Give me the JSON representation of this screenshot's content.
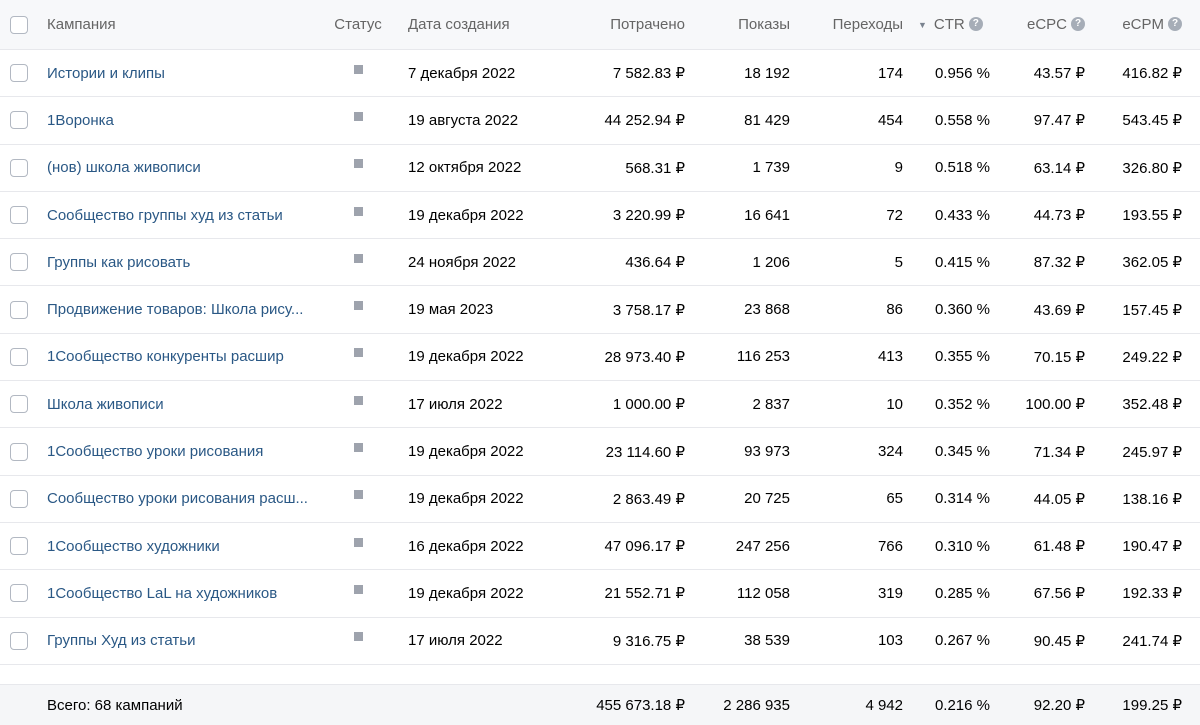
{
  "header": {
    "campaign": "Кампания",
    "status": "Статус",
    "created": "Дата создания",
    "spent": "Потрачено",
    "views": "Показы",
    "clicks": "Переходы",
    "ctr": "CTR",
    "ecpc": "eCPC",
    "ecpm": "eCPM",
    "help_glyph": "?",
    "sort_glyph": "▼"
  },
  "rows": [
    {
      "name": "Истории и клипы",
      "date": "7 декабря 2022",
      "spent": "7 582.83 ₽",
      "views": "18 192",
      "clicks": "174",
      "ctr": "0.956 %",
      "ecpc": "43.57 ₽",
      "ecpm": "416.82 ₽"
    },
    {
      "name": "1Воронка",
      "date": "19 августа 2022",
      "spent": "44 252.94 ₽",
      "views": "81 429",
      "clicks": "454",
      "ctr": "0.558 %",
      "ecpc": "97.47 ₽",
      "ecpm": "543.45 ₽"
    },
    {
      "name": "(нов) школа живописи",
      "date": "12 октября 2022",
      "spent": "568.31 ₽",
      "views": "1 739",
      "clicks": "9",
      "ctr": "0.518 %",
      "ecpc": "63.14 ₽",
      "ecpm": "326.80 ₽"
    },
    {
      "name": "Сообщество группы худ из статьи",
      "date": "19 декабря 2022",
      "spent": "3 220.99 ₽",
      "views": "16 641",
      "clicks": "72",
      "ctr": "0.433 %",
      "ecpc": "44.73 ₽",
      "ecpm": "193.55 ₽"
    },
    {
      "name": "Группы как рисовать",
      "date": "24 ноября 2022",
      "spent": "436.64 ₽",
      "views": "1 206",
      "clicks": "5",
      "ctr": "0.415 %",
      "ecpc": "87.32 ₽",
      "ecpm": "362.05 ₽"
    },
    {
      "name": "Продвижение товаров: Школа рису...",
      "date": "19 мая 2023",
      "spent": "3 758.17 ₽",
      "views": "23 868",
      "clicks": "86",
      "ctr": "0.360 %",
      "ecpc": "43.69 ₽",
      "ecpm": "157.45 ₽"
    },
    {
      "name": "1Сообщество конкуренты расшир",
      "date": "19 декабря 2022",
      "spent": "28 973.40 ₽",
      "views": "116 253",
      "clicks": "413",
      "ctr": "0.355 %",
      "ecpc": "70.15 ₽",
      "ecpm": "249.22 ₽"
    },
    {
      "name": "Школа живописи",
      "date": "17 июля 2022",
      "spent": "1 000.00 ₽",
      "views": "2 837",
      "clicks": "10",
      "ctr": "0.352 %",
      "ecpc": "100.00 ₽",
      "ecpm": "352.48 ₽"
    },
    {
      "name": "1Сообщество уроки рисования",
      "date": "19 декабря 2022",
      "spent": "23 114.60 ₽",
      "views": "93 973",
      "clicks": "324",
      "ctr": "0.345 %",
      "ecpc": "71.34 ₽",
      "ecpm": "245.97 ₽"
    },
    {
      "name": "Сообщество уроки рисования расш...",
      "date": "19 декабря 2022",
      "spent": "2 863.49 ₽",
      "views": "20 725",
      "clicks": "65",
      "ctr": "0.314 %",
      "ecpc": "44.05 ₽",
      "ecpm": "138.16 ₽"
    },
    {
      "name": "1Сообщество художники",
      "date": "16 декабря 2022",
      "spent": "47 096.17 ₽",
      "views": "247 256",
      "clicks": "766",
      "ctr": "0.310 %",
      "ecpc": "61.48 ₽",
      "ecpm": "190.47 ₽"
    },
    {
      "name": "1Сообщество LaL на художников",
      "date": "19 декабря 2022",
      "spent": "21 552.71 ₽",
      "views": "112 058",
      "clicks": "319",
      "ctr": "0.285 %",
      "ecpc": "67.56 ₽",
      "ecpm": "192.33 ₽"
    },
    {
      "name": "Группы Худ из статьи",
      "date": "17 июля 2022",
      "spent": "9 316.75 ₽",
      "views": "38 539",
      "clicks": "103",
      "ctr": "0.267 %",
      "ecpc": "90.45 ₽",
      "ecpm": "241.74 ₽"
    }
  ],
  "footer": {
    "total_label": "Всего: 68 кампаний",
    "spent": "455 673.18 ₽",
    "views": "2 286 935",
    "clicks": "4 942",
    "ctr": "0.216 %",
    "ecpc": "92.20 ₽",
    "ecpm": "199.25 ₽"
  },
  "colors": {
    "link": "#2a5885",
    "status_square": "#9ea3ad",
    "header_bg": "#f7f8fa",
    "footer_bg": "#f5f6f8"
  }
}
